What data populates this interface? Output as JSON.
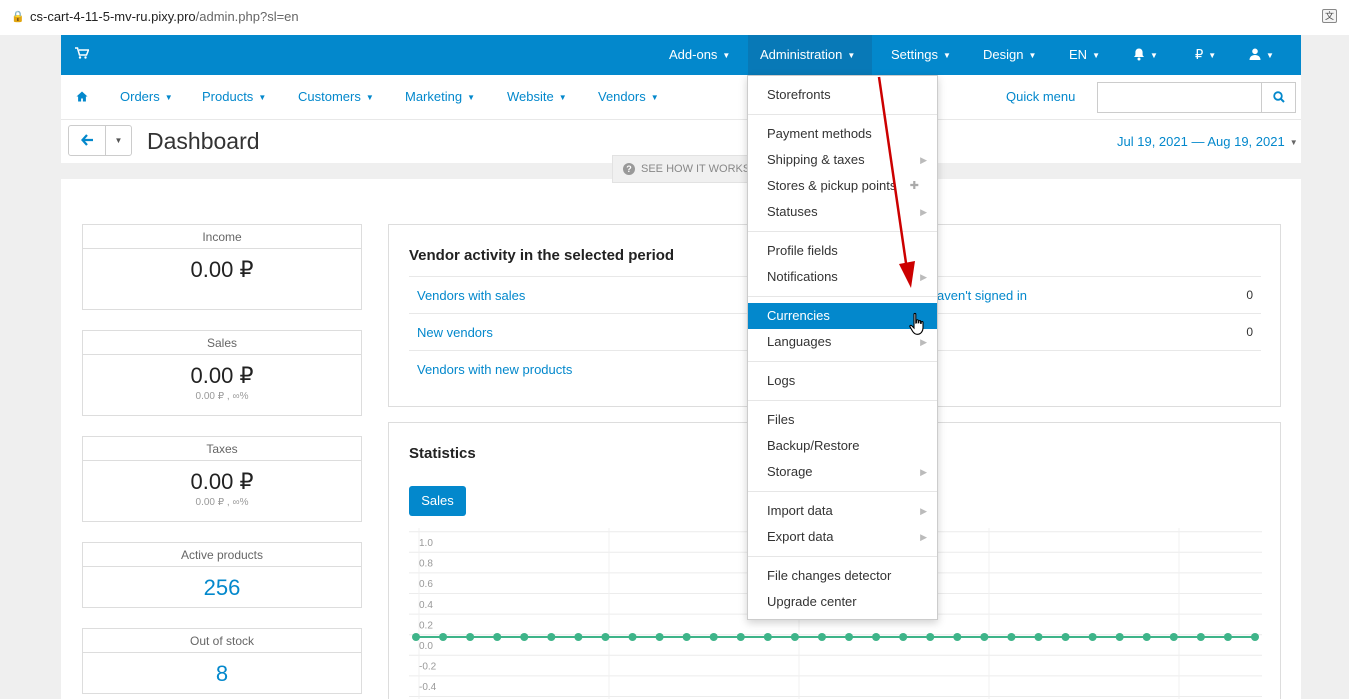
{
  "browser": {
    "url_host": "cs-cart-4-11-5-mv-ru.pixy.pro",
    "url_path": "/admin.php?sl=en"
  },
  "topbar": {
    "addons": "Add-ons",
    "administration": "Administration",
    "settings": "Settings",
    "design": "Design",
    "language": "EN",
    "currency": "₽"
  },
  "nav": {
    "orders": "Orders",
    "products": "Products",
    "customers": "Customers",
    "marketing": "Marketing",
    "website": "Website",
    "vendors": "Vendors",
    "quick_menu": "Quick menu",
    "search_value": ""
  },
  "title": {
    "page_title": "Dashboard",
    "date_range": "Jul 19, 2021 — Aug 19, 2021",
    "see_how": "SEE HOW IT WORKS"
  },
  "kpis": [
    {
      "label": "Income",
      "value": "0.00 ₽",
      "sub": ""
    },
    {
      "label": "Sales",
      "value": "0.00 ₽",
      "sub": "0.00 ₽ , ∞%"
    },
    {
      "label": "Taxes",
      "value": "0.00 ₽",
      "sub": "0.00 ₽ , ∞%"
    },
    {
      "label": "Active products",
      "value": "256",
      "sub": ""
    },
    {
      "label": "Out of stock",
      "value": "8",
      "sub": ""
    }
  ],
  "vendor_activity": {
    "title": "Vendor activity in the selected period",
    "rows": [
      {
        "left": "Vendors with sales",
        "right": "aven't signed in",
        "count": "0"
      },
      {
        "left": "New vendors",
        "right": "",
        "count": "0"
      },
      {
        "left": "Vendors with new products",
        "right": "",
        "count": ""
      }
    ]
  },
  "statistics": {
    "title": "Statistics",
    "tab": "Sales"
  },
  "dropdown": {
    "items": [
      {
        "label": "Storefronts",
        "sub": false
      },
      {
        "label": "Payment methods",
        "sub": false
      },
      {
        "label": "Shipping & taxes",
        "sub": true
      },
      {
        "label": "Stores & pickup points",
        "sub": false,
        "addon": true
      },
      {
        "label": "Statuses",
        "sub": true
      },
      {
        "label": "Profile fields",
        "sub": false
      },
      {
        "label": "Notifications",
        "sub": true
      },
      {
        "label": "Currencies",
        "sub": false,
        "active": true
      },
      {
        "label": "Languages",
        "sub": true
      },
      {
        "label": "Logs",
        "sub": false
      },
      {
        "label": "Files",
        "sub": false
      },
      {
        "label": "Backup/Restore",
        "sub": false
      },
      {
        "label": "Storage",
        "sub": true
      },
      {
        "label": "Import data",
        "sub": true
      },
      {
        "label": "Export data",
        "sub": true
      },
      {
        "label": "File changes detector",
        "sub": false
      },
      {
        "label": "Upgrade center",
        "sub": false
      }
    ]
  },
  "chart_data": {
    "type": "line",
    "yticks": [
      "1.0",
      "0.8",
      "0.6",
      "0.4",
      "0.2",
      "0.0",
      "-0.2",
      "-0.4"
    ],
    "ylim": [
      -0.4,
      1.0
    ],
    "series": [
      {
        "values": [
          0,
          0,
          0,
          0,
          0,
          0,
          0,
          0,
          0,
          0,
          0,
          0,
          0,
          0,
          0,
          0,
          0,
          0,
          0,
          0,
          0,
          0,
          0,
          0,
          0,
          0,
          0,
          0,
          0,
          0,
          0,
          0
        ]
      }
    ],
    "grid": true,
    "colors": {
      "line": "#3eb489"
    }
  },
  "colors": {
    "brand": "#0388cc",
    "active_menu": "#0388cc",
    "arrow": "#cc0000"
  }
}
